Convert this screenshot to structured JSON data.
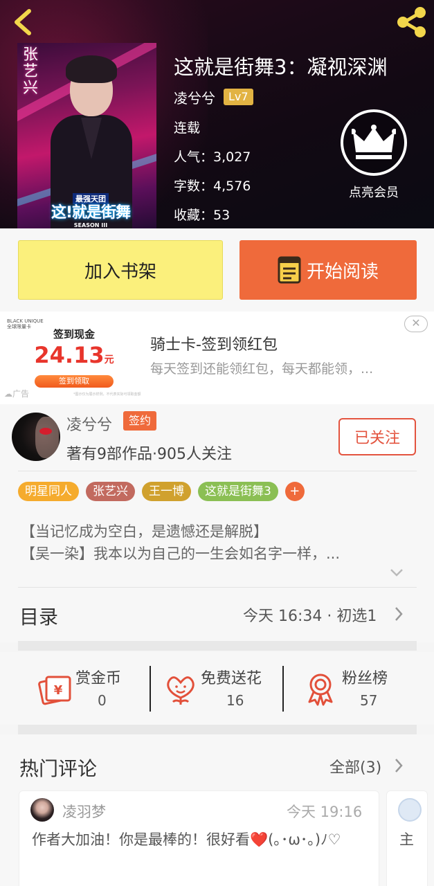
{
  "header": {
    "book_title": "这就是街舞3：凝视深渊",
    "author_name": "凌兮兮",
    "author_level": "Lv7",
    "status": "连载",
    "popularity": "人气：3,027",
    "word_count": "字数：4,576",
    "favorites": "收藏：53",
    "vip_label": "点亮会员",
    "cover": {
      "vertical_name": "张艺兴",
      "logo_top": "最强天团",
      "logo_main": "这!就是街舞",
      "logo_sub": "SEASON III"
    }
  },
  "actions": {
    "add_shelf_label": "加入书架",
    "start_read_label": "开始阅读"
  },
  "ad": {
    "brand": "BLACK UNIQUE\n全球限量卡",
    "sign_label": "签到现金",
    "amount": "24.13",
    "amount_unit": "元",
    "pill_label": "签到领取",
    "ad_tag": "广告",
    "fine_print": "*图示仅为展示样例，不代表实际可领取金额",
    "title": "骑士卡-签到领红包",
    "description": "每天签到还能领红包，每天都能领，..."
  },
  "author_card": {
    "name": "凌兮兮",
    "sign_badge": "签约",
    "info": "著有9部作品·905人关注",
    "follow_label": "已关注"
  },
  "tags": [
    {
      "label": "明星同人",
      "color": "#f5ab2d"
    },
    {
      "label": "张艺兴",
      "color": "#c26a5f"
    },
    {
      "label": "王一博",
      "color": "#d0a12e"
    },
    {
      "label": "这就是街舞3",
      "color": "#8bbf54"
    }
  ],
  "tag_plus": "+",
  "intro": {
    "line1": "【当记忆成为空白，是遗憾还是解脱】",
    "line2": "【吴一染】我本以为自己的一生会如名字一样，..."
  },
  "catalog": {
    "title": "目录",
    "latest": "今天 16:34 · 初选1"
  },
  "stats": [
    {
      "label": "赏金币",
      "value": "0",
      "icon": "red-envelope-icon"
    },
    {
      "label": "免费送花",
      "value": "16",
      "icon": "flower-icon"
    },
    {
      "label": "粉丝榜",
      "value": "57",
      "icon": "medal-icon"
    }
  ],
  "hot_comments": {
    "title": "热门评论",
    "all_label": "全部(3)",
    "items": [
      {
        "user": "凌羽梦",
        "time": "今天 19:16",
        "text": "作者大加油！你是最棒的！很好看❤️(｡･ω･｡)ﾉ♡"
      },
      {
        "text": "主"
      }
    ]
  },
  "colors": {
    "accent_orange": "#ef6a3b",
    "shelf_yellow": "#fbf07c",
    "follow_red": "#e3533e",
    "level_gold": "#e2b343",
    "icon_red": "#e2503a"
  }
}
